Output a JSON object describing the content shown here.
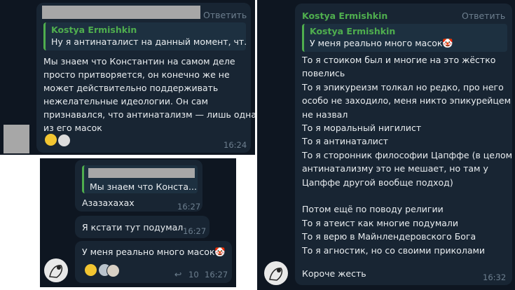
{
  "reply_label": "Ответить",
  "left_top": {
    "reply_sender": "Kostya Ermishkin",
    "reply_text": "Ну я антинаталист на данный момент, чт...",
    "body_lines": [
      "Мы знаем что Константин на самом деле",
      "просто притворяется, он конечно же не",
      "может действительно поддерживать",
      "нежелательные идеологии. Он сам",
      "признавался, что антинатализм — лишь одна",
      "из его масок"
    ],
    "time": "16:24"
  },
  "left_bottom": {
    "m1_reply_text": "Мы знаем что Конста...",
    "m1_text": "Азазахахах",
    "m1_time": "16:27",
    "m2_text": "Я кстати тут подумал",
    "m2_time": "16:27",
    "m3_text": "У меня реально много масок🤡",
    "m3_replies_count": "10",
    "m3_time": "16:27"
  },
  "right": {
    "sender": "Kostya Ermishkin",
    "reply_sender": "Kostya Ermishkin",
    "reply_text": "У меня реально много масок🤡",
    "body_lines": [
      "То я стоиком был и многие на это жёстко",
      "повелись",
      "То я эпикуреизм толкал но редко, про него",
      "особо не заходило, меня никто эпикурейцем",
      "не назвал",
      "То я моральный нигилист",
      "То я антинаталист",
      "То я сторонник философии Цапффе (в целом",
      "антинатализму это не мешает, но там у",
      "Цапффе другой вообще подход)",
      "",
      "Потом ещё по поводу религии",
      "То я атеист как многие подумали",
      "То я верю в Майнлендеровского Бога",
      "То я агностик, но со своими приколами"
    ],
    "last_line": "Короче жесть",
    "time": "16:32"
  },
  "colors": {
    "bg": "#0e1621",
    "bubble": "#182533",
    "accent": "#4fae4e",
    "meta": "#6d7f8f"
  }
}
